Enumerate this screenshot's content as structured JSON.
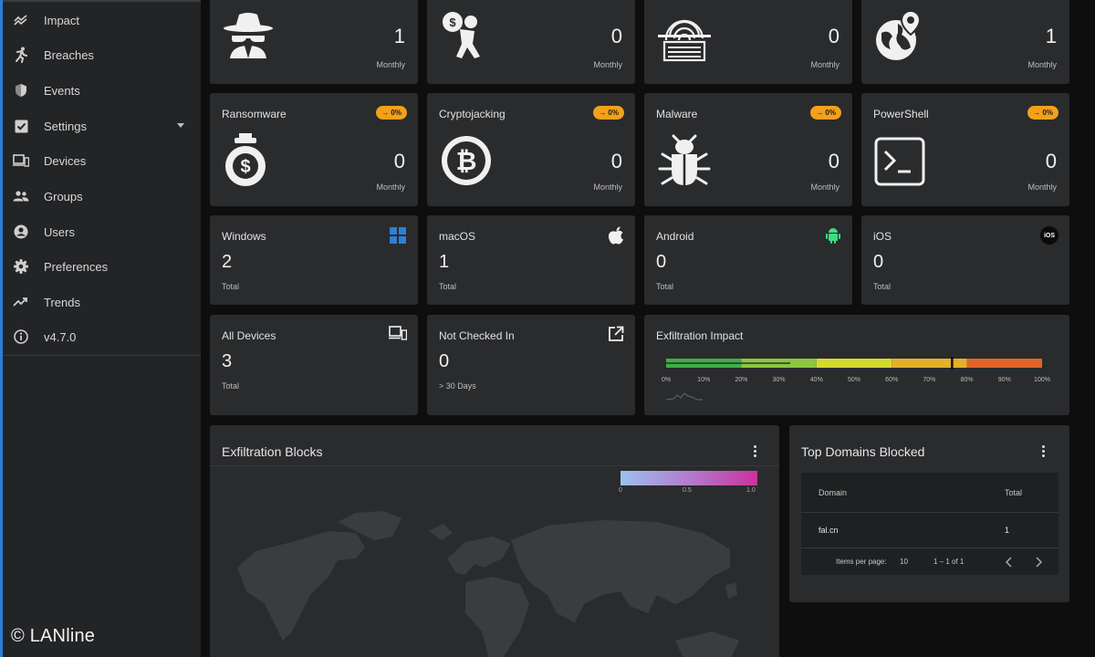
{
  "sidebar": {
    "items": [
      {
        "label": "Impact",
        "icon": "impact-icon"
      },
      {
        "label": "Breaches",
        "icon": "runner-icon"
      },
      {
        "label": "Events",
        "icon": "shield-icon"
      },
      {
        "label": "Settings",
        "icon": "checkbox-icon"
      },
      {
        "label": "Devices",
        "icon": "devices-icon"
      },
      {
        "label": "Groups",
        "icon": "groups-icon"
      },
      {
        "label": "Users",
        "icon": "user-icon"
      },
      {
        "label": "Preferences",
        "icon": "gear-icon"
      },
      {
        "label": "Trends",
        "icon": "trending-up-icon"
      },
      {
        "label": "v4.7.0",
        "icon": "info-icon"
      }
    ]
  },
  "watermark": "© LANline",
  "top_row": [
    {
      "value": "1",
      "period": "Monthly",
      "icon": "spy-icon"
    },
    {
      "value": "0",
      "period": "Monthly",
      "icon": "thief-icon"
    },
    {
      "value": "0",
      "period": "Monthly",
      "icon": "fingerprint-icon"
    },
    {
      "value": "1",
      "period": "Monthly",
      "icon": "globe-pin-icon"
    }
  ],
  "threats": [
    {
      "title": "Ransomware",
      "badge": "→ 0%",
      "value": "0",
      "period": "Monthly",
      "icon": "money-lock-icon"
    },
    {
      "title": "Cryptojacking",
      "badge": "→ 0%",
      "value": "0",
      "period": "Monthly",
      "icon": "bitcoin-icon"
    },
    {
      "title": "Malware",
      "badge": "→ 0%",
      "value": "0",
      "period": "Monthly",
      "icon": "bug-icon"
    },
    {
      "title": "PowerShell",
      "badge": "→ 0%",
      "value": "0",
      "period": "Monthly",
      "icon": "terminal-icon"
    }
  ],
  "platforms": [
    {
      "title": "Windows",
      "value": "2",
      "sub": "Total",
      "icon": "windows-icon"
    },
    {
      "title": "macOS",
      "value": "1",
      "sub": "Total",
      "icon": "apple-icon"
    },
    {
      "title": "Android",
      "value": "0",
      "sub": "Total",
      "icon": "android-icon"
    },
    {
      "title": "iOS",
      "value": "0",
      "sub": "Total",
      "icon": "ios-icon",
      "icon_text": "iOS"
    }
  ],
  "all_devices": {
    "title": "All Devices",
    "value": "3",
    "sub": "Total"
  },
  "not_checked_in": {
    "title": "Not Checked In",
    "value": "0",
    "sub": "> 30 Days"
  },
  "exfiltration_impact": {
    "title": "Exfiltration Impact",
    "scale": [
      "0%",
      "10%",
      "20%",
      "30%",
      "40%",
      "50%",
      "60%",
      "70%",
      "80%",
      "90%",
      "100%"
    ],
    "marker_percent": 76,
    "segments": [
      {
        "from": 0,
        "to": 20,
        "color": "#3fae49"
      },
      {
        "from": 20,
        "to": 40,
        "color": "#8cc63f"
      },
      {
        "from": 40,
        "to": 60,
        "color": "#d4d930"
      },
      {
        "from": 60,
        "to": 80,
        "color": "#e3b02a"
      },
      {
        "from": 80,
        "to": 100,
        "color": "#e0642a"
      }
    ]
  },
  "exfiltration_blocks": {
    "title": "Exfiltration Blocks",
    "legend_ticks": [
      "0",
      "0.5",
      "1.0"
    ],
    "gradient": [
      "#9cc1ee",
      "#b27ccf",
      "#c9339c"
    ]
  },
  "top_domains": {
    "title": "Top Domains Blocked",
    "columns": [
      "Domain",
      "Total"
    ],
    "rows": [
      {
        "domain": "fal.cn",
        "total": "1"
      }
    ],
    "items_per_page_label": "Items per page:",
    "items_per_page": "10",
    "range": "1 – 1 of 1"
  }
}
